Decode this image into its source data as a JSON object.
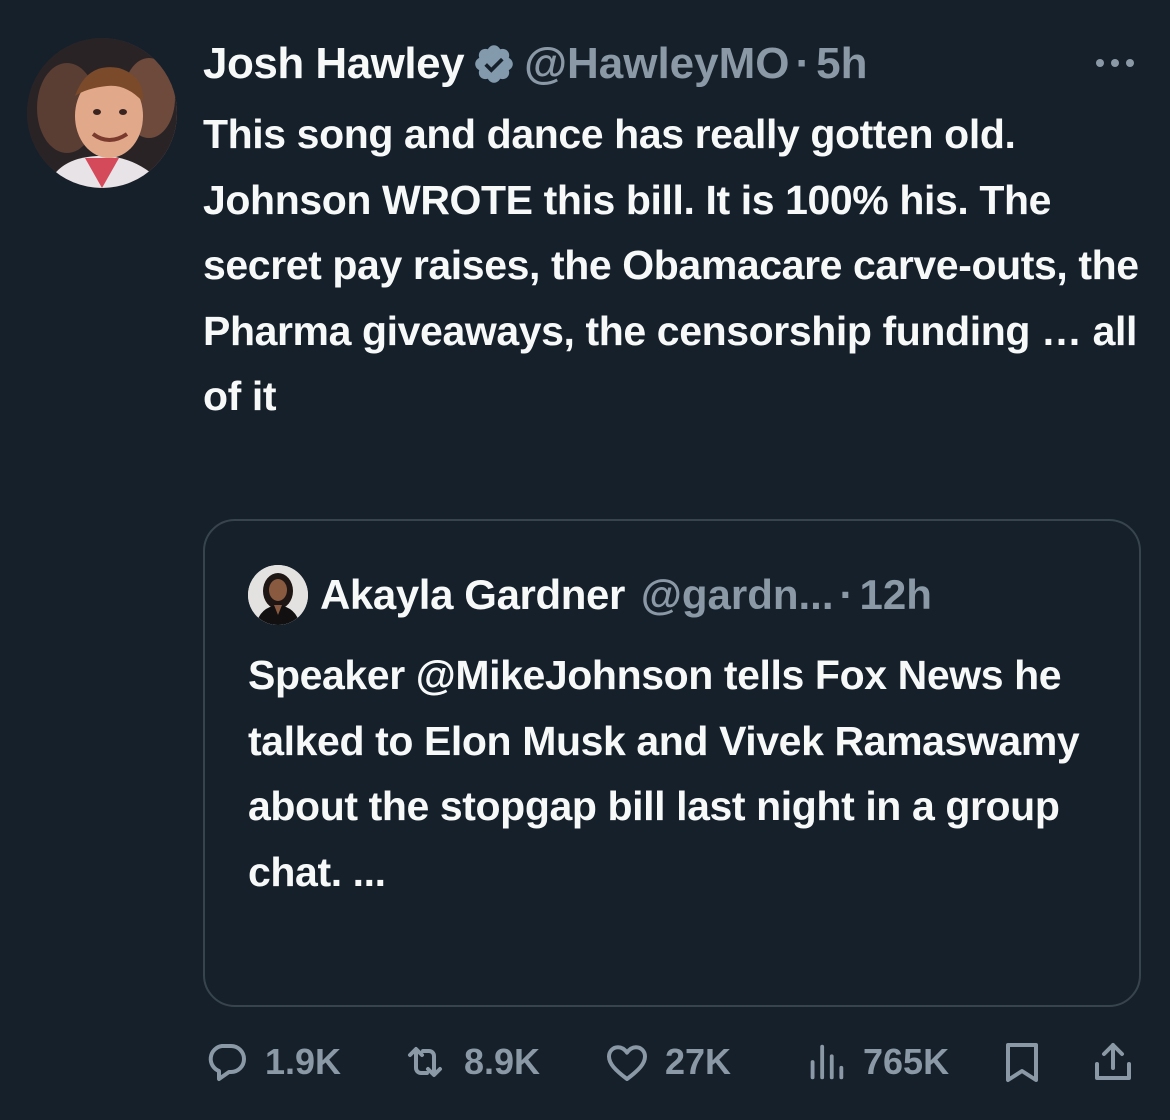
{
  "tweet": {
    "author_name": "Josh Hawley",
    "handle": "@HawleyMO",
    "separator": "·",
    "time": "5h",
    "avatar_icon": "profile-photo",
    "verified_icon": "verified-badge-icon",
    "more_icon": "more-dots-icon",
    "text": "This song and dance has really gotten old. Johnson WROTE this bill. It is 100% his. The secret pay raises, the Obamacare carve-outs, the Pharma giveaways, the censorship funding … all of it"
  },
  "quote": {
    "author_name": "Akayla Gardner",
    "handle": "@gardn...",
    "separator": "·",
    "time": "12h",
    "avatar_icon": "profile-photo",
    "text": "Speaker @MikeJohnson tells Fox News he talked to Elon Musk and Vivek Ramaswamy about the stopgap bill last night in a group chat. ..."
  },
  "actions": {
    "replies": "1.9K",
    "retweets": "8.9K",
    "likes": "27K",
    "views": "765K"
  },
  "colors": {
    "background": "#15202b",
    "text_primary": "#f7f9f9",
    "text_secondary": "#8b98a5",
    "border": "#38444d",
    "verified_badge": "#829aab"
  }
}
